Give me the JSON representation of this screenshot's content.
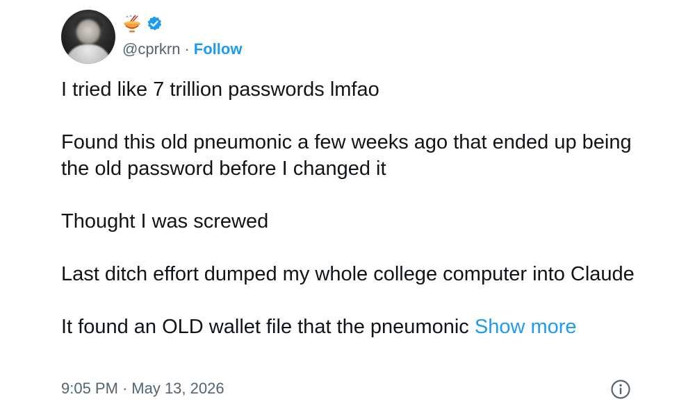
{
  "author": {
    "name_icon": "ramen-bowl-icon",
    "verified_icon": "verified-badge-icon",
    "handle": "@cprkrn",
    "separator": "·",
    "follow_label": "Follow"
  },
  "tweet": {
    "paragraphs": [
      "I tried like 7 trillion passwords lmfao",
      "Found this old pneumonic a few weeks ago that ended up being the old password before I changed it",
      "Thought I was screwed",
      "Last ditch effort dumped my whole college computer into Claude"
    ],
    "last_paragraph": "It found an OLD wallet file that the pneumonic",
    "show_more_label": "Show more"
  },
  "meta": {
    "time": "9:05 PM",
    "separator": "·",
    "date": "May 13, 2026",
    "info_icon": "info-icon"
  },
  "colors": {
    "link_blue": "#1d9bf0",
    "secondary_text": "#536471",
    "primary_text": "#0f1419"
  }
}
